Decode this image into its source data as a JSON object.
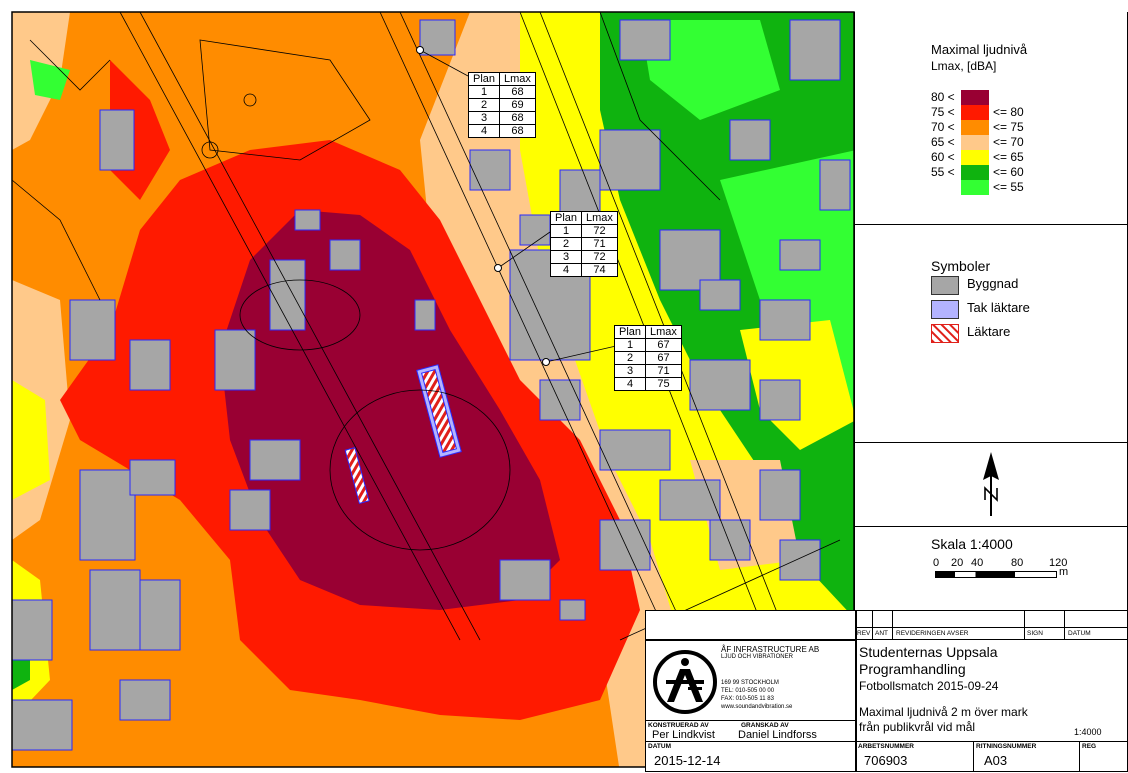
{
  "legend": {
    "title": "Maximal ljudnivå",
    "subtitle": "Lmax, [dBA]",
    "rows": [
      {
        "lower": "80 <",
        "upper": "",
        "color": "#990033"
      },
      {
        "lower": "75 <",
        "upper": "<= 80",
        "color": "#ff1a00"
      },
      {
        "lower": "70 <",
        "upper": "<= 75",
        "color": "#ff8c00"
      },
      {
        "lower": "65 <",
        "upper": "<= 70",
        "color": "#ffc98a"
      },
      {
        "lower": "60 <",
        "upper": "<= 65",
        "color": "#ffff00"
      },
      {
        "lower": "55 <",
        "upper": "<= 60",
        "color": "#0fb30f"
      },
      {
        "lower": "",
        "upper": "<= 55",
        "color": "#33ff33"
      }
    ]
  },
  "symbols": {
    "title": "Symboler",
    "items": [
      {
        "label": "Byggnad",
        "color": "#a6a6a6"
      },
      {
        "label": "Tak läktare",
        "color": "#b3b3ff"
      },
      {
        "label": "Läktare",
        "color": "hatched-red"
      }
    ]
  },
  "north_arrow": {
    "icon": "north-arrow-icon",
    "letter": "N"
  },
  "scale": {
    "title": "Skala 1:4000",
    "ticks": [
      "0",
      "20",
      "40",
      "80",
      "120"
    ],
    "unit": "m"
  },
  "receivers": [
    {
      "header": [
        "Plan",
        "Lmax"
      ],
      "rows": [
        [
          "1",
          "68"
        ],
        [
          "2",
          "69"
        ],
        [
          "3",
          "68"
        ],
        [
          "4",
          "68"
        ]
      ]
    },
    {
      "header": [
        "Plan",
        "Lmax"
      ],
      "rows": [
        [
          "1",
          "72"
        ],
        [
          "2",
          "71"
        ],
        [
          "3",
          "72"
        ],
        [
          "4",
          "74"
        ]
      ]
    },
    {
      "header": [
        "Plan",
        "Lmax"
      ],
      "rows": [
        [
          "1",
          "67"
        ],
        [
          "2",
          "67"
        ],
        [
          "3",
          "71"
        ],
        [
          "4",
          "75"
        ]
      ]
    }
  ],
  "title_block": {
    "revision_headers": {
      "rev": "REV",
      "ant": "ANT",
      "revideringen": "REVIDERINGEN AVSER",
      "sign": "SIGN",
      "datum": "DATUM"
    },
    "company": {
      "name": "ÅF INFRASTRUCTURE AB",
      "dept": "LJUD OCH VIBRATIONER",
      "address": "169 99 STOCKHOLM",
      "tel": "TEL:   010-505 00 00",
      "fax": "FAX:  010-505 11 83",
      "web": "www.soundandvibration.se",
      "logo": "af-logo"
    },
    "project": {
      "line1": "Studenternas Uppsala",
      "line2": "Programhandling",
      "line3": "Fotbollsmatch 2015-09-24"
    },
    "description": {
      "line1": "Maximal ljudnivå 2 m över mark",
      "line2": "från publikvrål vid mål",
      "scale": "1:4000"
    },
    "konstruerad_label": "KONSTRUERAD AV",
    "konstruerad": "Per Lindkvist",
    "granskad_label": "GRANSKAD AV",
    "granskad": "Daniel Lindforss",
    "datum_label": "DATUM",
    "datum": "2015-12-14",
    "arbetsnummer_label": "ARBETSNUMMER",
    "arbetsnummer": "706903",
    "ritningsnummer_label": "RITNINGSNUMMER",
    "ritningsnummer": "A03",
    "reg_label": "REG"
  }
}
